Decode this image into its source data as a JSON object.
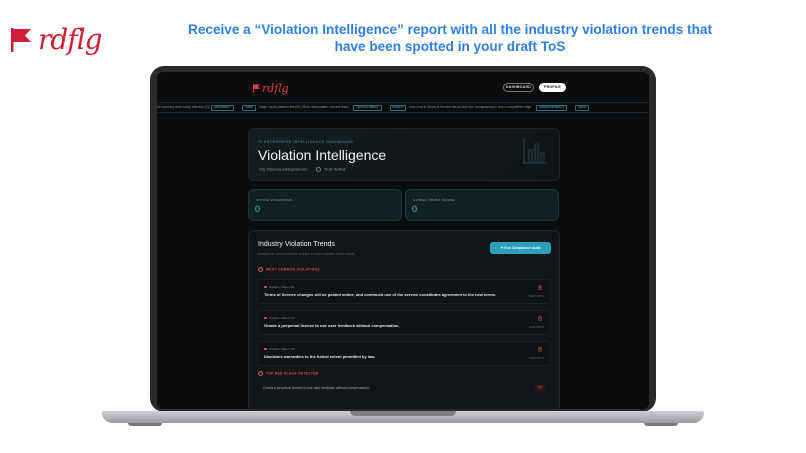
{
  "brand": {
    "name": "rdflg",
    "color": "#d01f36"
  },
  "headline": {
    "line1": "Receive a “Violation Intelligence” report with all the industry violation trends that",
    "line2": "have been spotted in your draft ToS",
    "color": "#2f7fe0"
  },
  "app": {
    "logo": "rdflg",
    "nav": {
      "dashboard": "DASHBOARD",
      "profile": "PROFILE"
    },
    "ticker": [
      {
        "text": "ot Licensing done solely effective (21)",
        "tag": "HIGH IMPACT"
      },
      {
        "tag": "ALERT",
        "text": "Major social platform fined €1.2B for dark pattern consent flows"
      },
      {
        "tag": "CRITICAL IMPACT",
        "text": ""
      },
      {
        "tag": "INSIGHT",
        "text": "User trust in Terms of Service hits all-time low: transparency is now a competitive edge"
      },
      {
        "tag": "MODERATE IMPACT",
        "text": ""
      },
      {
        "tag": "LEGAL",
        "text": ""
      }
    ],
    "hero": {
      "eyebrow": "ENTERPRISE INTELLIGENCE DASHBOARD",
      "title": "Violation Intelligence",
      "org": "Org: bilaenoq.null@gmail.com",
      "status": "Trust Verified"
    },
    "stats": [
      {
        "label": "ACTIVE VIOLATIONS",
        "value": "0"
      },
      {
        "label": "GLOBAL TRUST SCORE",
        "value": "0"
      }
    ],
    "trends": {
      "title": "Industry Violation Trends",
      "subtitle": "COMMON VIOLATIONS & RED FLAGS FROM ANALYSES",
      "audit_button": "Run Compliance Audit",
      "most_common_heading": "MOST COMMON VIOLATIONS",
      "violations": [
        {
          "pattern": "Violation Pattern #1",
          "text": "Terms of Service changes will be posted online, and continued use of the service constitutes agreement to the new terms.",
          "count": "8",
          "unit": "REPORTS"
        },
        {
          "pattern": "Violation Pattern #2",
          "text": "Grants a perpetual license to use user feedback without compensation.",
          "count": "8",
          "unit": "REPORTS"
        },
        {
          "pattern": "Violation Pattern #3",
          "text": "Disclaims warranties to the fullest extent permitted by law.",
          "count": "8",
          "unit": "REPORTS"
        }
      ],
      "red_flags_heading": "TOP RED FLAGS DETECTED",
      "red_flags": [
        {
          "text": "Grants a perpetual license to use user feedback without compensation.",
          "badge": "1/8"
        }
      ]
    }
  }
}
